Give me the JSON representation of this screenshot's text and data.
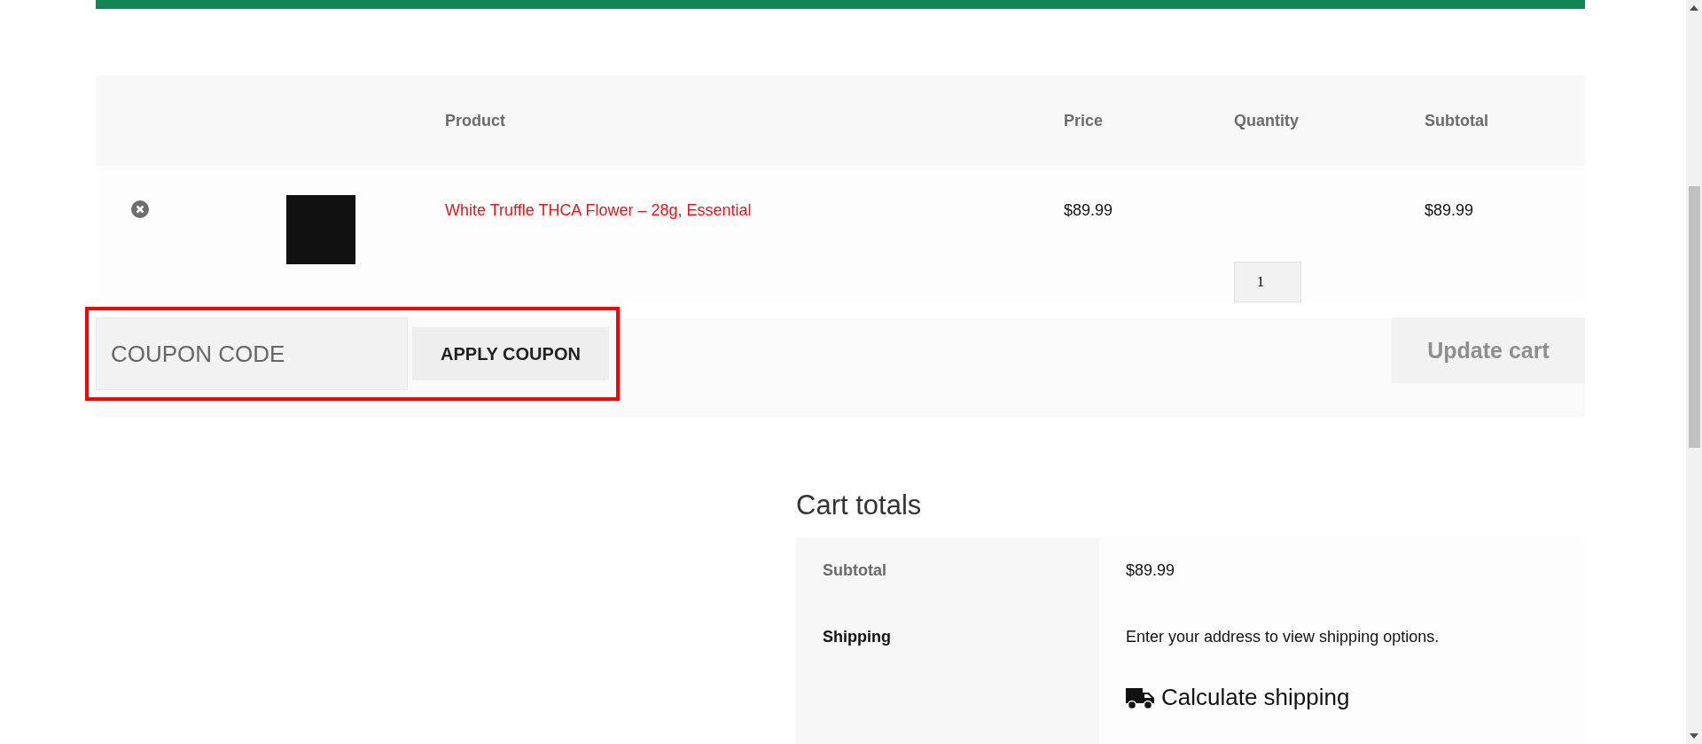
{
  "cart_table": {
    "columns": [
      {
        "label": "Product"
      },
      {
        "label": "Price"
      },
      {
        "label": "Quantity"
      },
      {
        "label": "Subtotal"
      }
    ],
    "rows": [
      {
        "product": "White Truffle THCA Flower – 28g, Essential",
        "price": "$89.99",
        "quantity": "1",
        "subtotal": "$89.99"
      }
    ]
  },
  "coupon": {
    "placeholder": "COUPON CODE",
    "button": "APPLY COUPON",
    "highlighted": true
  },
  "update_button": {
    "label": "Update cart",
    "disabled": true
  },
  "cart_totals": {
    "title": "Cart totals",
    "rows": [
      {
        "kind": "amount",
        "label": "Subtotal",
        "value": "$89.99"
      },
      {
        "kind": "shipping",
        "label": "Shipping",
        "value": "Enter your address to view shipping options.",
        "link": "Calculate shipping"
      }
    ]
  }
}
